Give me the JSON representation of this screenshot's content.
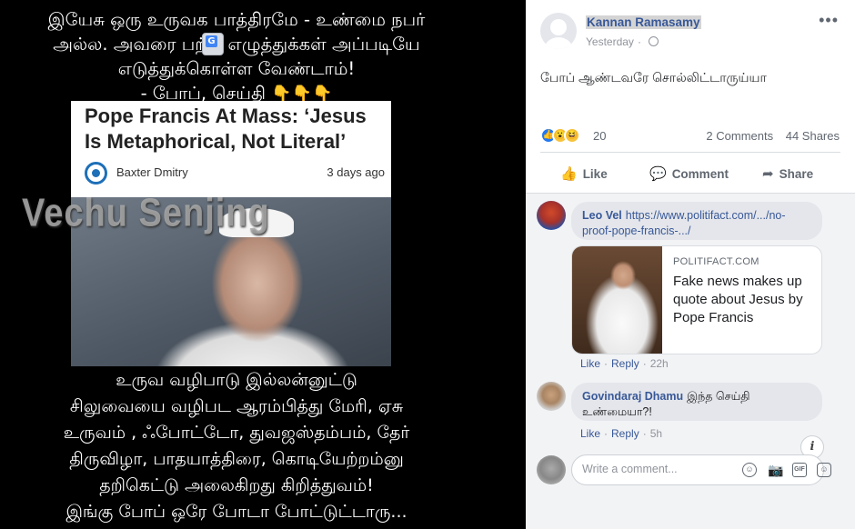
{
  "image_post": {
    "top_text": [
      "இயேசு ஒரு உருவக பாத்திரமே - உண்மை நபர்",
      "அல்ல. அவரை பற்றி எழுத்துக்கள் அப்படியே",
      "எடுத்துக்கொள்ள வேண்டாம்!",
      "- போப், செய்தி"
    ],
    "pointing_emojis": "👇👇👇",
    "article": {
      "headline": "Pope Francis At Mass: ‘Jesus Is Metaphorical, Not Literal’",
      "author": "Baxter Dmitry",
      "date": "3 days ago"
    },
    "watermark": "Vechu Senjing",
    "bottom_text": [
      "உருவ வழிபாடு இல்லன்னுட்டு",
      "சிலுவையை வழிபட ஆரம்பித்து மேரி, ஏசு",
      "உருவம் , ஃபோட்டோ, துவஜஸ்தம்பம், தேர்",
      "திருவிழா, பாதயாத்திரை, கொடியேற்றம்னு",
      "தறிகெட்டு அலைகிறது கிறித்துவம்!",
      "இங்கு போப் ஒரே போடா போட்டுட்டாரு..."
    ]
  },
  "post": {
    "author": "Kannan Ramasamy",
    "time": "Yesterday",
    "more": "•••",
    "text": "போப் ஆண்டவரே சொல்லிட்டாருய்யா",
    "reaction_count": "20",
    "comments_count": "2 Comments",
    "shares_count": "44 Shares",
    "actions": {
      "like": "Like",
      "comment": "Comment",
      "share": "Share"
    }
  },
  "comments": [
    {
      "name": "Leo Vel",
      "link": "https://www.politifact.com/.../no-proof-pope-francis-.../",
      "link_card": {
        "source": "POLITIFACT.COM",
        "title": "Fake news makes up quote about Jesus by Pope Francis"
      },
      "like": "Like",
      "reply": "Reply",
      "time": "22h"
    },
    {
      "name": "Govindaraj Dhamu",
      "text": "இந்த செய்தி உண்மையா?!",
      "like": "Like",
      "reply": "Reply",
      "time": "5h"
    }
  ],
  "composer": {
    "placeholder": "Write a comment..."
  },
  "colors": {
    "link_blue": "#385898",
    "like_blue": "#2078f4",
    "meta_grey": "#90949c"
  },
  "icons": [
    "like-reaction-icon",
    "wow-reaction-icon",
    "haha-reaction-icon",
    "globe-icon",
    "info-icon",
    "emoji-icon",
    "camera-icon",
    "gif-icon",
    "sticker-icon"
  ]
}
